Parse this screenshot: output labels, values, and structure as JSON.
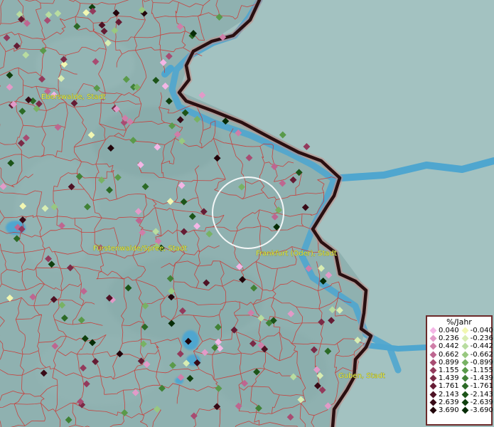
{
  "labels": [
    {
      "name": "Eberswalde, Stadt"
    },
    {
      "name": "Fürstenwalde/Spree, Stadt"
    },
    {
      "name": "Frankfurt (Oder), Stadt"
    },
    {
      "name": "Guben, Stadt"
    }
  ],
  "legend": {
    "title": "%/Jahr",
    "positive": [
      {
        "label": "0.040",
        "color": "#f4b6e6"
      },
      {
        "label": "0.236",
        "color": "#e29ac8"
      },
      {
        "label": "0.442",
        "color": "#cf7ea8"
      },
      {
        "label": "0.662",
        "color": "#be6690"
      },
      {
        "label": "0.899",
        "color": "#a84c72"
      },
      {
        "label": "1.155",
        "color": "#933a5c"
      },
      {
        "label": "1.439",
        "color": "#7b2a46"
      },
      {
        "label": "1.761",
        "color": "#651c34"
      },
      {
        "label": "2.143",
        "color": "#4e1224"
      },
      {
        "label": "2.639",
        "color": "#380a16"
      },
      {
        "label": "3.690",
        "color": "#22040a"
      }
    ],
    "negative": [
      {
        "label": "-0.040",
        "color": "#f2f7b2"
      },
      {
        "label": "-0.236",
        "color": "#d8edb2"
      },
      {
        "label": "-0.442",
        "color": "#b8dca0"
      },
      {
        "label": "-0.662",
        "color": "#98c880"
      },
      {
        "label": "-0.899",
        "color": "#78b264"
      },
      {
        "label": "-1.155",
        "color": "#5a9a4a"
      },
      {
        "label": "-1.439",
        "color": "#418236"
      },
      {
        "label": "-1.761",
        "color": "#2c6a26"
      },
      {
        "label": "-2.143",
        "color": "#1c5418"
      },
      {
        "label": "-2.639",
        "color": "#10400e"
      },
      {
        "label": "-3.690",
        "color": "#062c06"
      }
    ]
  },
  "colors": {
    "land": "#8fb1b0",
    "east_land": "#a3c2c1",
    "water": "#4fa6cf",
    "district_border": "#d0302c",
    "national_border": "#2a0f10",
    "label_text": "#e6e84a",
    "circle": "#ffffff"
  }
}
